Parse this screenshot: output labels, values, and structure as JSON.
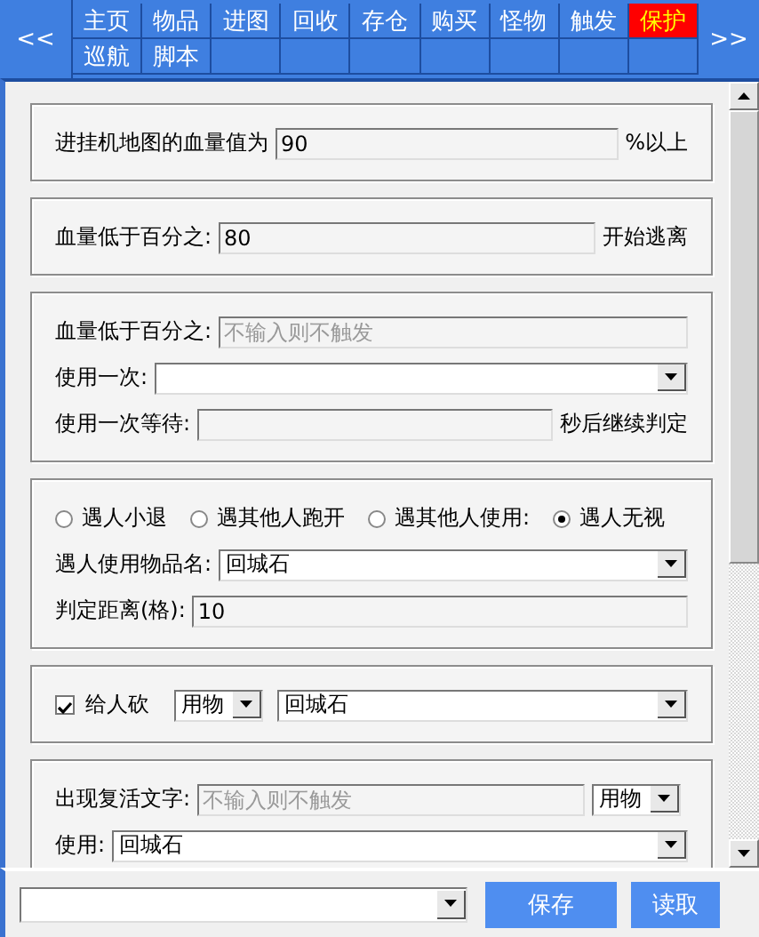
{
  "nav": {
    "prev": "<<",
    "next": ">>",
    "tabs": [
      {
        "label": "主页",
        "selected": false
      },
      {
        "label": "物品",
        "selected": false
      },
      {
        "label": "进图",
        "selected": false
      },
      {
        "label": "回收",
        "selected": false
      },
      {
        "label": "存仓",
        "selected": false
      },
      {
        "label": "购买",
        "selected": false
      },
      {
        "label": "怪物",
        "selected": false
      },
      {
        "label": "触发",
        "selected": false
      },
      {
        "label": "保护",
        "selected": true
      },
      {
        "label": "巡航",
        "selected": false
      },
      {
        "label": "脚本",
        "selected": false
      }
    ]
  },
  "groups": [
    {
      "rows": [
        {
          "items": [
            {
              "kind": "label",
              "text": "进挂机地图的血量值为"
            },
            {
              "kind": "input",
              "value": "90"
            },
            {
              "kind": "label",
              "text": "%以上"
            }
          ]
        }
      ]
    },
    {
      "rows": [
        {
          "items": [
            {
              "kind": "label",
              "text": "血量低于百分之:"
            },
            {
              "kind": "input",
              "value": "80"
            },
            {
              "kind": "label",
              "text": "开始逃离"
            }
          ]
        }
      ]
    },
    {
      "rows": [
        {
          "items": [
            {
              "kind": "label",
              "text": "血量低于百分之:"
            },
            {
              "kind": "input",
              "placeholder": "不输入则不触发"
            }
          ]
        },
        {
          "items": [
            {
              "kind": "label",
              "text": "使用一次:"
            },
            {
              "kind": "select"
            }
          ]
        },
        {
          "items": [
            {
              "kind": "label",
              "text": "使用一次等待:"
            },
            {
              "kind": "input"
            },
            {
              "kind": "label",
              "text": "秒后继续判定"
            }
          ]
        }
      ]
    },
    {
      "rows": [
        {
          "items": [
            {
              "kind": "radio",
              "text": "遇人小退",
              "selected": false
            },
            {
              "kind": "radio",
              "text": "遇其他人跑开",
              "selected": false
            },
            {
              "kind": "radio",
              "text": "遇其他人使用:",
              "selected": false
            },
            {
              "kind": "radio",
              "text": "遇人无视",
              "selected": true
            }
          ]
        },
        {
          "items": [
            {
              "kind": "label",
              "text": "遇人使用物品名:"
            },
            {
              "kind": "select",
              "value": "回城石"
            }
          ]
        },
        {
          "items": [
            {
              "kind": "label",
              "text": "判定距离(格):"
            },
            {
              "kind": "input",
              "value": "10"
            }
          ]
        }
      ]
    },
    {
      "rows": [
        {
          "items": [
            {
              "kind": "checkbox",
              "text": "给人砍",
              "checked": true
            },
            {
              "kind": "small-select",
              "value": "用物"
            },
            {
              "kind": "select",
              "value": "回城石"
            }
          ]
        }
      ]
    },
    {
      "rows": [
        {
          "items": [
            {
              "kind": "label",
              "text": "出现复活文字:"
            },
            {
              "kind": "input",
              "placeholder": "不输入则不触发"
            },
            {
              "kind": "small-select",
              "value": "用物"
            }
          ]
        },
        {
          "items": [
            {
              "kind": "label",
              "text": "使用:"
            },
            {
              "kind": "select",
              "value": "回城石"
            }
          ]
        }
      ]
    }
  ],
  "footer": {
    "buttons": [
      "保存",
      "读取"
    ]
  }
}
